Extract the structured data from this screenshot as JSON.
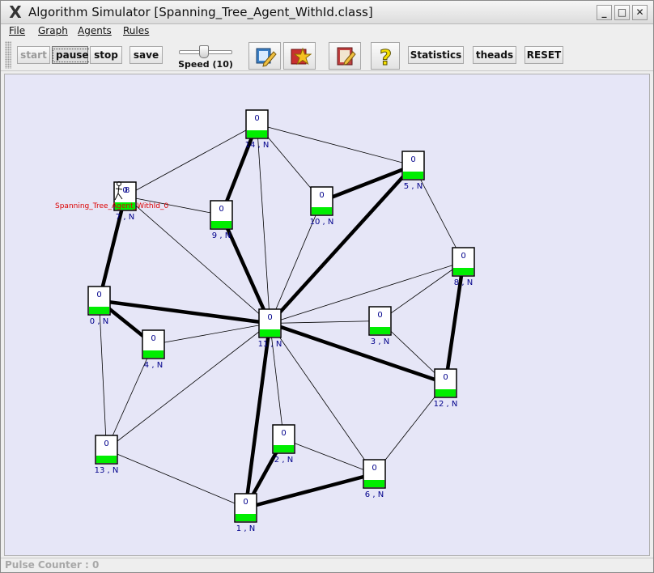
{
  "window": {
    "title": "Algorithm Simulator [Spanning_Tree_Agent_WithId.class]",
    "controls": {
      "minimize": "_",
      "maximize": "□",
      "close": "✕"
    }
  },
  "menu": [
    "File",
    "Graph",
    "Agents",
    "Rules"
  ],
  "toolbar": {
    "start": "start",
    "pause": "pause",
    "stop": "stop",
    "save": "save",
    "speed_label": "Speed (10)",
    "statistics": "Statistics",
    "theads": "theads",
    "reset": "RESET",
    "icons": [
      "edit-graph-icon",
      "star-agent-icon",
      "rules-book-icon",
      "help-question-icon"
    ]
  },
  "graph": {
    "agent_label": "Spanning_Tree_Agent_WithId_0",
    "node_values": [
      "0",
      "0",
      "0",
      "0",
      "0",
      "0",
      "0",
      "0",
      "0",
      "0",
      "0",
      "0",
      "0",
      "0",
      "0"
    ],
    "node_labels": [
      "0 , N",
      "1 , N",
      "2 , N",
      "3 , N",
      "4 , N",
      "5 , N",
      "6 , N",
      "7 , N",
      "8 , N",
      "9 , N",
      "10 , N",
      "11 , N",
      "12 , N",
      "13 , N",
      "14 , N"
    ],
    "agent_counter": "8",
    "colors": {
      "canvas": "#e6e6f7",
      "node_fill": "#ffffff",
      "node_bar": "#00ee00",
      "label": "#00008b",
      "agent_label": "#dd0000"
    }
  },
  "status": {
    "pulse_counter": "Pulse Counter : 0"
  }
}
